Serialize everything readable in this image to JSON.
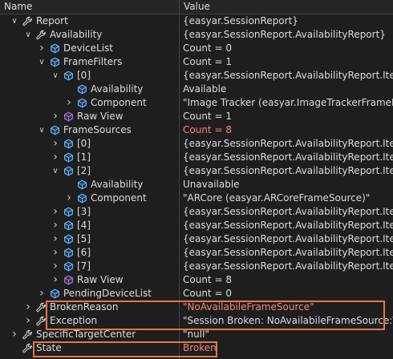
{
  "header": {
    "name": "Name",
    "value": "Value"
  },
  "rows": [
    {
      "indent": 0,
      "expander": "open",
      "icon": "wrench",
      "name": "Report",
      "value": "{easyar.SessionReport}"
    },
    {
      "indent": 1,
      "expander": "open",
      "icon": "wrench",
      "name": "Availability",
      "value": "{easyar.SessionReport.AvailabilityReport}"
    },
    {
      "indent": 2,
      "expander": "closed",
      "icon": "field",
      "name": "DeviceList",
      "value": "Count = 0"
    },
    {
      "indent": 2,
      "expander": "open",
      "icon": "field",
      "name": "FrameFilters",
      "value": "Count = 1"
    },
    {
      "indent": 3,
      "expander": "open",
      "icon": "field",
      "name": "[0]",
      "value": "{easyar.SessionReport.AvailabilityReport.Item}"
    },
    {
      "indent": 4,
      "expander": "none",
      "icon": "field",
      "name": "Availability",
      "value": "Available"
    },
    {
      "indent": 4,
      "expander": "closed",
      "icon": "field",
      "name": "Component",
      "value": "\"Image Tracker (easyar.ImageTrackerFrameFilter)\""
    },
    {
      "indent": 3,
      "expander": "closed",
      "icon": "rawview",
      "name": "Raw View",
      "value": "Count = 1"
    },
    {
      "indent": 2,
      "expander": "open",
      "icon": "field",
      "name": "FrameSources",
      "value": "Count = 8",
      "value_red": true
    },
    {
      "indent": 3,
      "expander": "closed",
      "icon": "field",
      "name": "[0]",
      "value": "{easyar.SessionReport.AvailabilityReport.Item}"
    },
    {
      "indent": 3,
      "expander": "closed",
      "icon": "field",
      "name": "[1]",
      "value": "{easyar.SessionReport.AvailabilityReport.Item}"
    },
    {
      "indent": 3,
      "expander": "open",
      "icon": "field",
      "name": "[2]",
      "value": "{easyar.SessionReport.AvailabilityReport.Item}"
    },
    {
      "indent": 4,
      "expander": "none",
      "icon": "field",
      "name": "Availability",
      "value": "Unavailable"
    },
    {
      "indent": 4,
      "expander": "closed",
      "icon": "field",
      "name": "Component",
      "value": "\"ARCore (easyar.ARCoreFrameSource)\""
    },
    {
      "indent": 3,
      "expander": "closed",
      "icon": "field",
      "name": "[3]",
      "value": "{easyar.SessionReport.AvailabilityReport.Item}"
    },
    {
      "indent": 3,
      "expander": "closed",
      "icon": "field",
      "name": "[4]",
      "value": "{easyar.SessionReport.AvailabilityReport.Item}"
    },
    {
      "indent": 3,
      "expander": "closed",
      "icon": "field",
      "name": "[5]",
      "value": "{easyar.SessionReport.AvailabilityReport.Item}"
    },
    {
      "indent": 3,
      "expander": "closed",
      "icon": "field",
      "name": "[6]",
      "value": "{easyar.SessionReport.AvailabilityReport.Item}"
    },
    {
      "indent": 3,
      "expander": "closed",
      "icon": "field",
      "name": "[7]",
      "value": "{easyar.SessionReport.AvailabilityReport.Item}"
    },
    {
      "indent": 3,
      "expander": "closed",
      "icon": "rawview",
      "name": "Raw View",
      "value": "Count = 8"
    },
    {
      "indent": 2,
      "expander": "closed",
      "icon": "field",
      "name": "PendingDeviceList",
      "value": "Count = 0"
    },
    {
      "indent": 1,
      "expander": "closed",
      "icon": "wrench",
      "name": "BrokenReason",
      "value": "\"NoAvailabileFrameSource\"",
      "value_red": true
    },
    {
      "indent": 1,
      "expander": "closed",
      "icon": "wrench",
      "name": "Exception",
      "value": "\"Session Broken: NoAvailabileFrameSource:\\r\\nThe"
    },
    {
      "indent": 0,
      "expander": "closed",
      "icon": "wrench",
      "name": "SpecificTargetCenter",
      "value": "\"null\""
    },
    {
      "indent": 0,
      "expander": "none",
      "icon": "wrench",
      "name": "State",
      "value": "Broken",
      "value_red": true
    }
  ],
  "colors": {
    "background": "#1e1e1e",
    "header": "#252526",
    "highlight": "#e8744a",
    "changed_value": "#f48771",
    "field_icon": "#75beff",
    "rawview_icon": "#b180d7"
  }
}
